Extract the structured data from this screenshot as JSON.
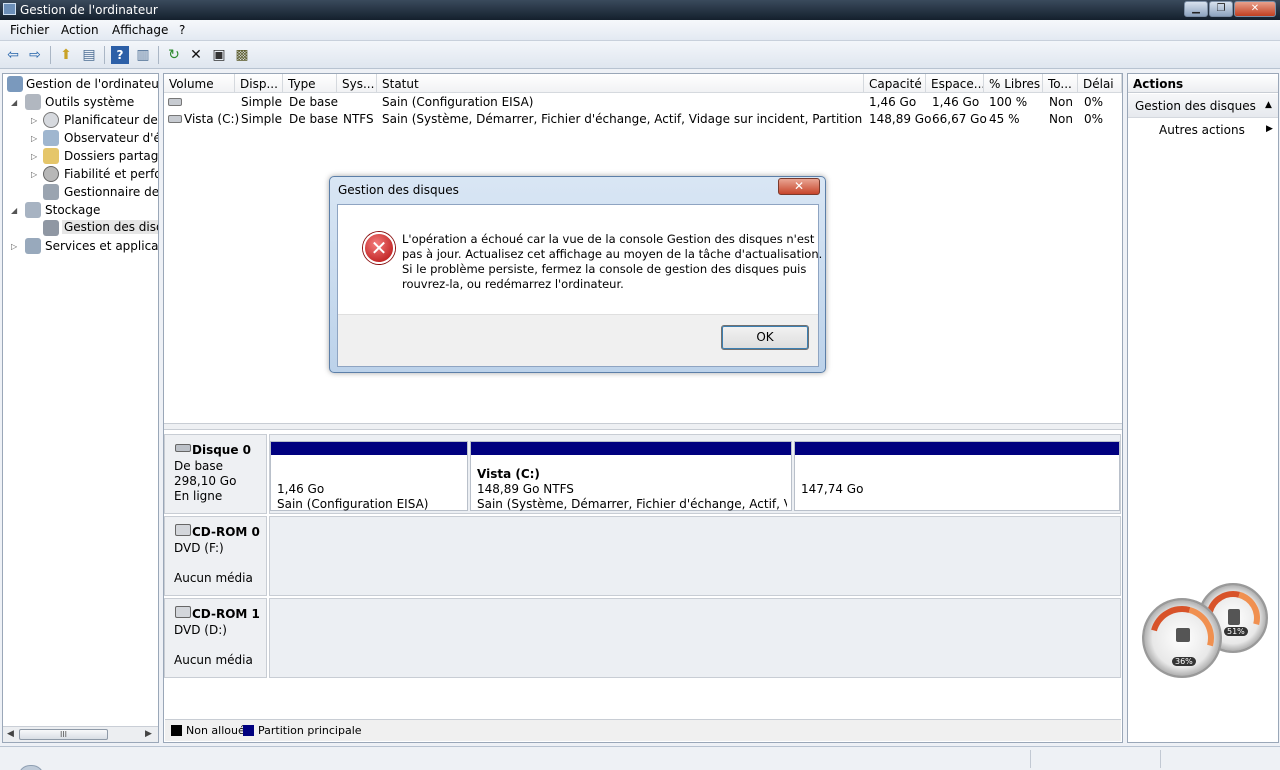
{
  "window": {
    "title": "Gestion de l'ordinateur"
  },
  "menu": [
    "Fichier",
    "Action",
    "Affichage",
    "?"
  ],
  "tree": {
    "root": "Gestion de l'ordinateur (l",
    "system_tools": "Outils système",
    "task_scheduler": "Planificateur de tâ",
    "event_viewer": "Observateur d'évé",
    "shared_folders": "Dossiers partagés",
    "reliability": "Fiabilité et perfor",
    "device_manager": "Gestionnaire de p",
    "storage": "Stockage",
    "disk_management": "Gestion des disqu",
    "services": "Services et application",
    "hscroll": "III"
  },
  "columns": [
    "Volume",
    "Disp...",
    "Type",
    "Sys...",
    "Statut",
    "Capacité",
    "Espace...",
    "% Libres",
    "To...",
    "Délai"
  ],
  "volumes": [
    {
      "volume": "",
      "layout": "Simple",
      "type": "De base",
      "fs": "",
      "status": "Sain (Configuration EISA)",
      "capacity": "1,46 Go",
      "free": "1,46 Go",
      "pct_free": "100 %",
      "fault_tolerance": "Non",
      "overhead": "0%"
    },
    {
      "volume": "Vista (C:)",
      "layout": "Simple",
      "type": "De base",
      "fs": "NTFS",
      "status": "Sain (Système, Démarrer, Fichier d'échange, Actif, Vidage sur incident, Partition principale)",
      "capacity": "148,89 Go",
      "free": "66,67 Go",
      "pct_free": "45 %",
      "fault_tolerance": "Non",
      "overhead": "0%"
    }
  ],
  "disks": {
    "disk0": {
      "name": "Disque 0",
      "type": "De base",
      "size": "298,10 Go",
      "state": "En ligne"
    },
    "cdrom0": {
      "name": "CD-ROM 0",
      "drive": "DVD (F:)",
      "media": "Aucun média"
    },
    "cdrom1": {
      "name": "CD-ROM 1",
      "drive": "DVD (D:)",
      "media": "Aucun média"
    }
  },
  "partitions": {
    "p1": {
      "size": "1,46 Go",
      "status": "Sain (Configuration EISA)"
    },
    "p2": {
      "name": "Vista  (C:)",
      "size": "148,89 Go NTFS",
      "status": "Sain (Système, Démarrer, Fichier d'échange, Actif, Vidage s"
    },
    "p3": {
      "size": "147,74 Go"
    }
  },
  "legend": {
    "unallocated": "Non alloué",
    "primary": "Partition principale"
  },
  "colors": {
    "unallocated": "#000000",
    "primary": "#00007f"
  },
  "actions": {
    "header": "Actions",
    "section": "Gestion des disques",
    "more": "Autres actions"
  },
  "dialog": {
    "title": "Gestion des disques",
    "message": [
      "L'opération a échoué car la vue de la console Gestion des disques n'est",
      "pas à jour. Actualisez cet affichage au moyen de la tâche d'actualisation.",
      "Si le problème persiste, fermez la console de gestion des disques puis",
      "rouvrez-la, ou redémarrez l'ordinateur."
    ],
    "ok": "OK"
  },
  "gadget": {
    "cpu": "36%",
    "memory": "51%"
  }
}
